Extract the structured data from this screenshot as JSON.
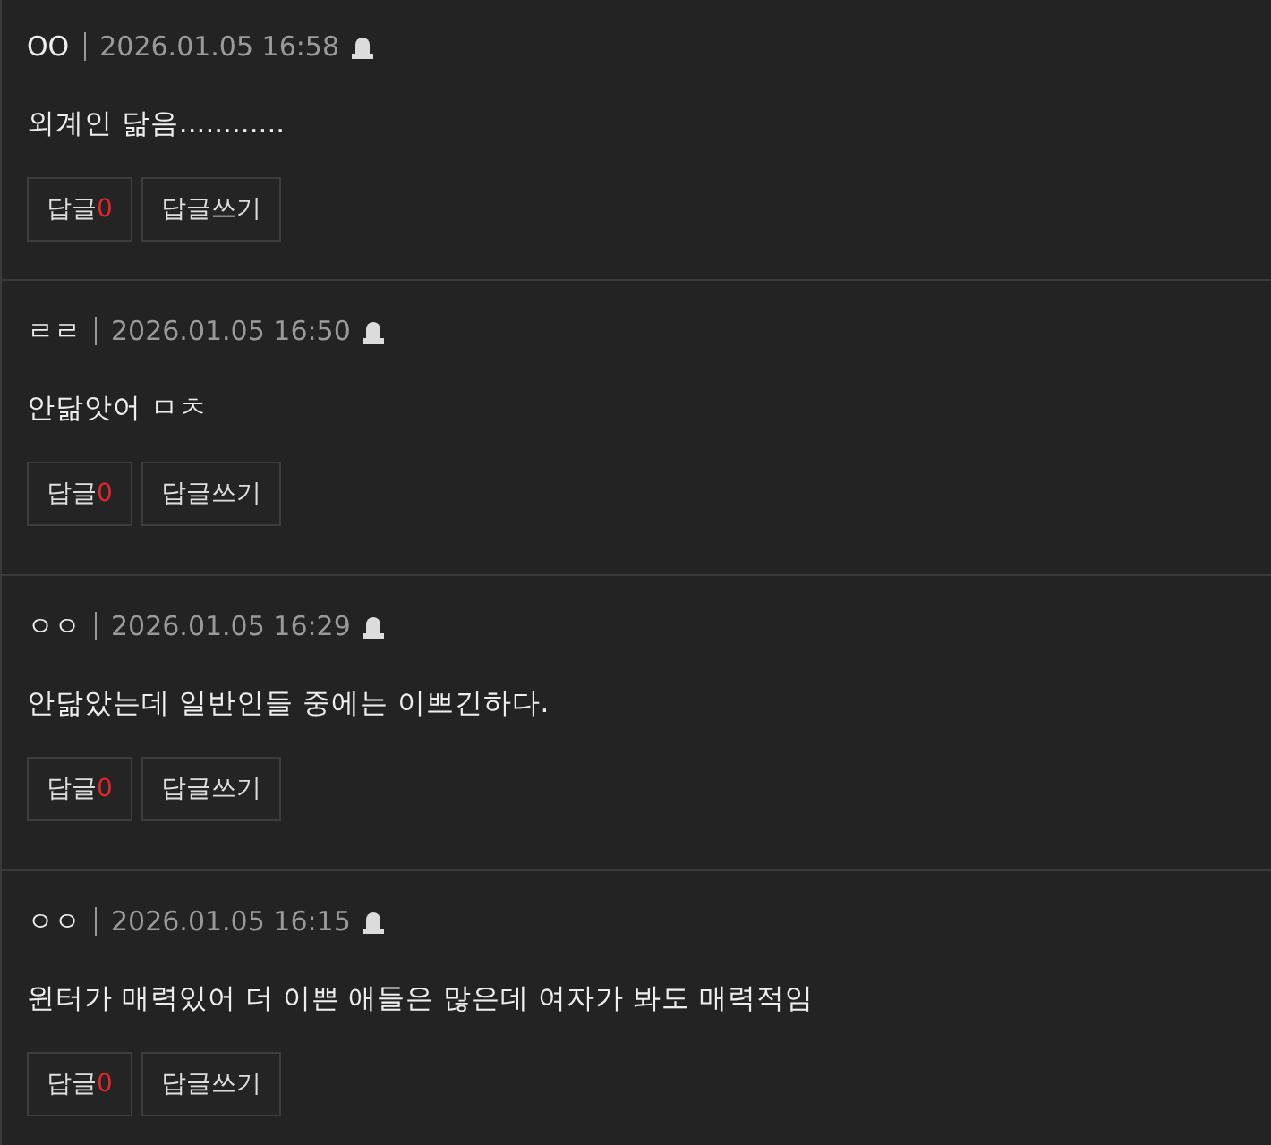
{
  "comments": [
    {
      "author": "OO",
      "date": "2026.01.05 16:58",
      "body": "외계인 닮음............",
      "reply_label": "답글",
      "reply_count": "0",
      "write_label": "답글쓰기"
    },
    {
      "author": "ㄹㄹ",
      "date": "2026.01.05 16:50",
      "body": "안닮앗어 ㅁㅊ",
      "reply_label": "답글",
      "reply_count": "0",
      "write_label": "답글쓰기"
    },
    {
      "author": "ㅇㅇ",
      "date": "2026.01.05 16:29",
      "body": "안닮았는데 일반인들 중에는 이쁘긴하다.",
      "reply_label": "답글",
      "reply_count": "0",
      "write_label": "답글쓰기"
    },
    {
      "author": "ㅇㅇ",
      "date": "2026.01.05 16:15",
      "body": "윈터가 매력있어 더 이쁜 애들은 많은데 여자가 봐도 매력적임",
      "reply_label": "답글",
      "reply_count": "0",
      "write_label": "답글쓰기"
    }
  ]
}
